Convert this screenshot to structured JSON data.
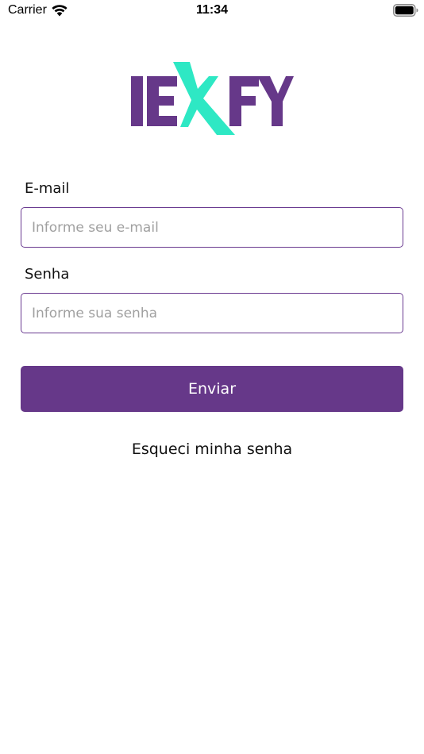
{
  "status_bar": {
    "carrier": "Carrier",
    "time": "11:34",
    "wifi_icon": "wifi-icon",
    "battery_icon": "battery-full-icon"
  },
  "logo": {
    "text": "IEXFY",
    "colors": {
      "primary": "#663889",
      "accent": "#2ee8c4"
    }
  },
  "form": {
    "email": {
      "label": "E-mail",
      "placeholder": "Informe seu e-mail",
      "value": ""
    },
    "password": {
      "label": "Senha",
      "placeholder": "Informe sua senha",
      "value": ""
    },
    "submit_label": "Enviar",
    "forgot_password_label": "Esqueci minha senha"
  },
  "theme": {
    "primary": "#663889",
    "input_border": "#6a3a90",
    "placeholder": "#a0a0a0",
    "background": "#ffffff"
  }
}
